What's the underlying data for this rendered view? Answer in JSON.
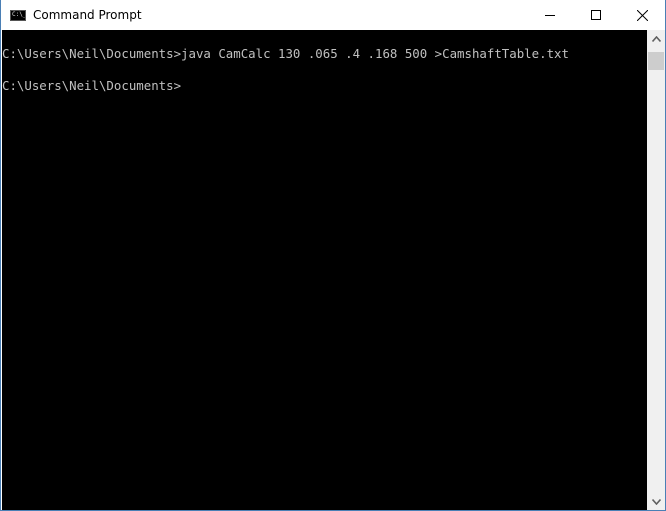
{
  "window": {
    "title": "Command Prompt",
    "icon": "cmd-icon",
    "icon_text": "C:\\_",
    "controls": {
      "minimize": "minimize-icon",
      "maximize": "maximize-icon",
      "close": "close-icon"
    }
  },
  "console": {
    "lines": [
      "C:\\Users\\Neil\\Documents>java CamCalc 130 .065 .4 .168 500 >CamshaftTable.txt",
      "",
      "C:\\Users\\Neil\\Documents>"
    ],
    "colors": {
      "background": "#000000",
      "foreground": "#c0c0c0"
    }
  },
  "scrollbar": {
    "up": "chevron-up-icon",
    "down": "chevron-down-icon"
  }
}
